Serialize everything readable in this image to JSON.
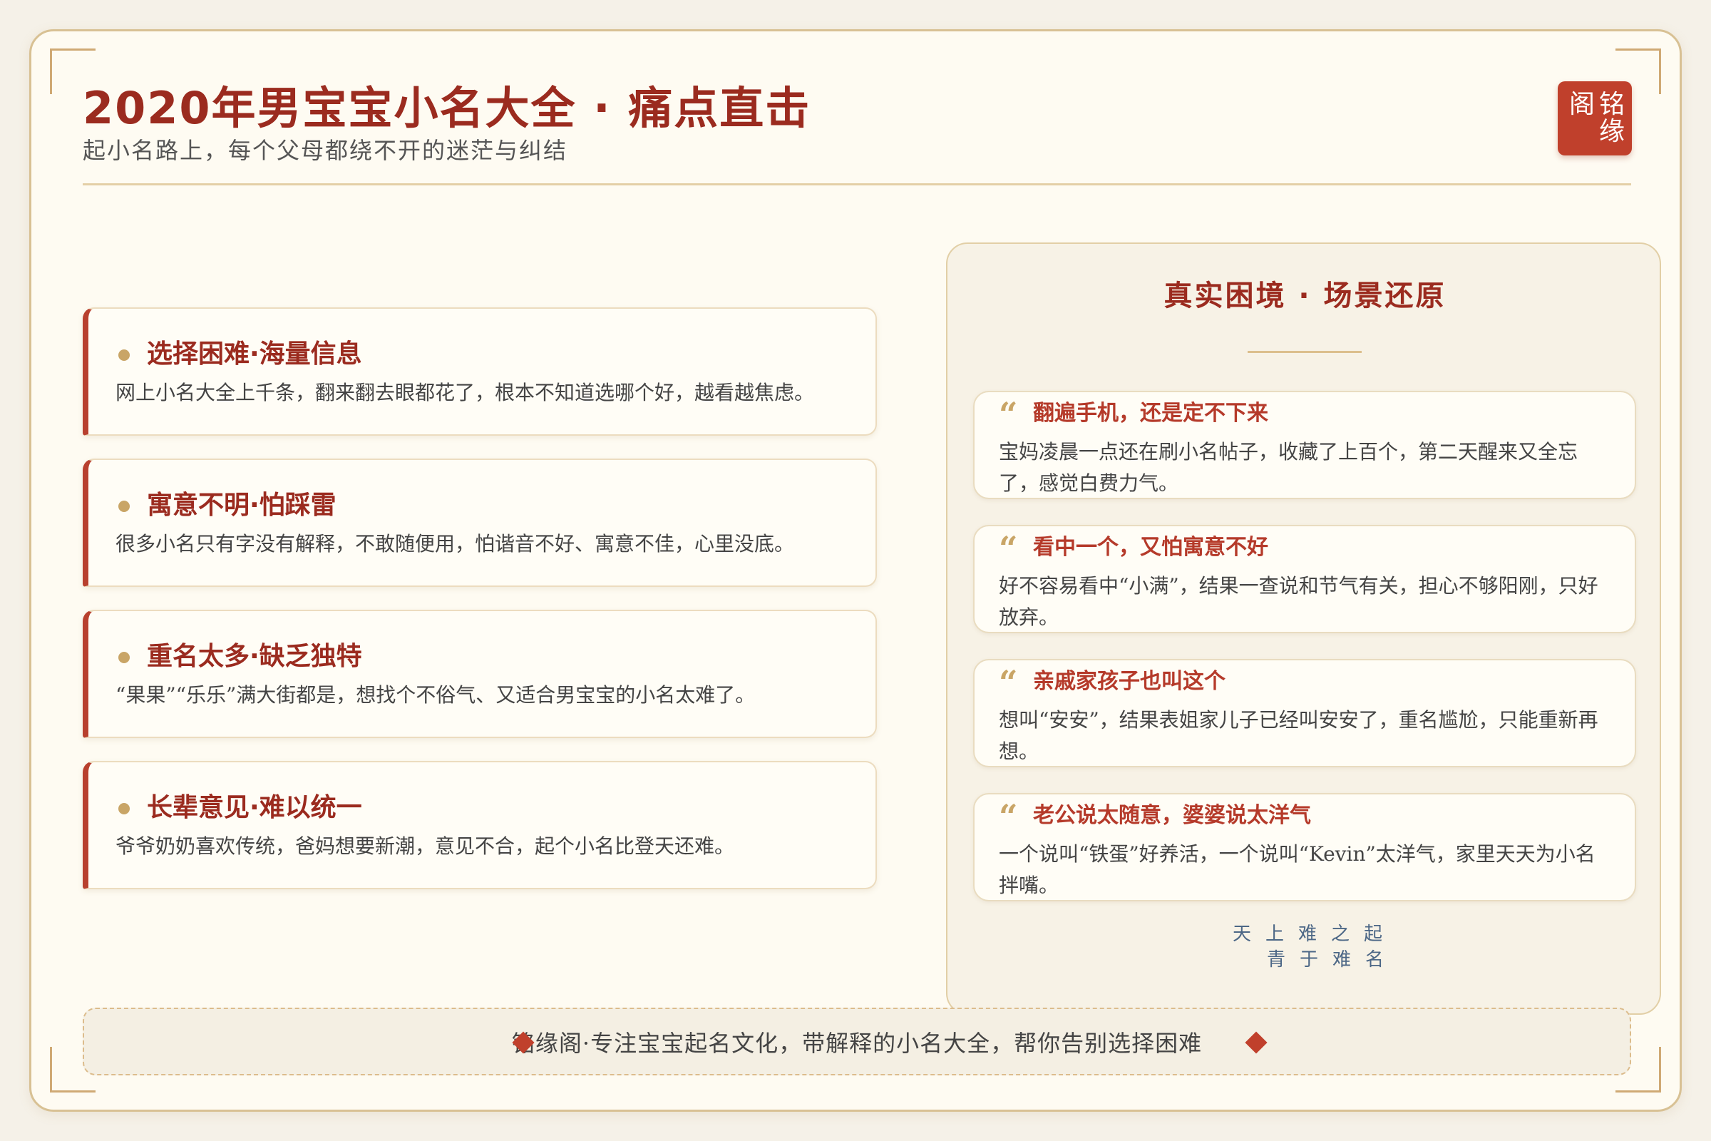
{
  "header": {
    "title": "2020年男宝宝小名大全 · 痛点直击",
    "subtitle": "起小名路上，每个父母都绕不开的迷茫与纠结",
    "seal_chars": [
      "铭",
      "阁",
      "缘"
    ]
  },
  "pain_points": [
    {
      "title": "选择困难·海量信息",
      "text": "网上小名大全上千条，翻来翻去眼都花了，根本不知道选哪个好，越看越焦虑。"
    },
    {
      "title": "寓意不明·怕踩雷",
      "text": "很多小名只有字没有解释，不敢随便用，怕谐音不好、寓意不佳，心里没底。"
    },
    {
      "title": "重名太多·缺乏独特",
      "text": "“果果”“乐乐”满大街都是，想找个不俗气、又适合男宝宝的小名太难了。"
    },
    {
      "title": "长辈意见·难以统一",
      "text": "爷爷奶奶喜欢传统，爸妈想要新潮，意见不合，起个小名比登天还难。"
    }
  ],
  "scenes_panel": {
    "title": "真实困境 · 场景还原",
    "quote_mark": "“",
    "scenes": [
      {
        "title": "翻遍手机，还是定不下来",
        "text": "宝妈凌晨一点还在刷小名帖子，收藏了上百个，第二天醒来又全忘了，感觉白费力气。"
      },
      {
        "title": "看中一个，又怕寓意不好",
        "text": "好不容易看中“小满”，结果一查说和节气有关，担心不够阳刚，只好放弃。"
      },
      {
        "title": "亲戚家孩子也叫这个",
        "text": "想叫“安安”，结果表姐家儿子已经叫安安了，重名尴尬，只能重新再想。"
      },
      {
        "title": "老公说太随意，婆婆说太洋气",
        "text": "一个说叫“铁蛋”好养活，一个说叫“Kevin”太洋气，家里天天为小名拌嘴。"
      }
    ],
    "poem_line1": "天上难之起",
    "poem_line2": "青于难名"
  },
  "footer": {
    "text": "铭缘阁·专注宝宝起名文化，带解释的小名大全，帮你告别选择困难"
  },
  "colors": {
    "accent_red": "#9b2b1f",
    "seal_red": "#c0402c",
    "gold": "#c9a566",
    "background": "#fefbf2"
  }
}
